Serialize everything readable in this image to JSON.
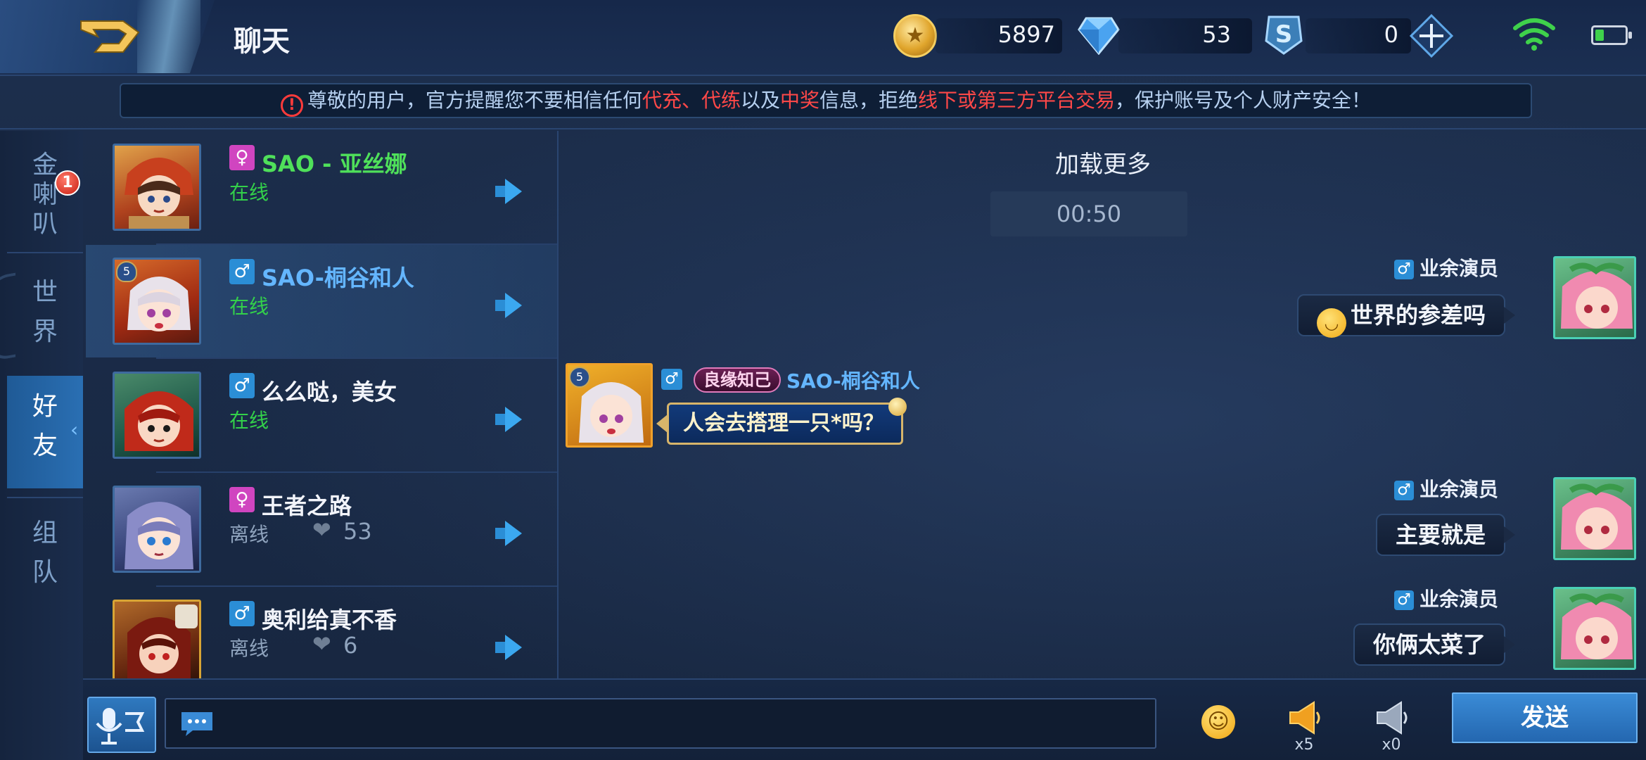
{
  "header": {
    "title": "聊天",
    "gold": "5897",
    "diamonds": "53",
    "vouchers": "0"
  },
  "notice": {
    "p1": "尊敬的用户，官方提醒您不要相信任何",
    "r1": "代充、代练",
    "p2": "以及",
    "r2": "中奖",
    "p3": "信息，拒绝",
    "r3": "线下或第三方平台交易",
    "p4": "，保护账号及个人财产安全！"
  },
  "tabs": [
    {
      "label": "金\n喇\n叭"
    },
    {
      "label": "世\n界"
    },
    {
      "label": "好\n友"
    },
    {
      "label": "组\n队"
    }
  ],
  "tab_badge": "1",
  "friends": [
    {
      "name": "SAO - 亚丝娜",
      "gender": "♀",
      "status": "在线",
      "name_color": "#4fe05a"
    },
    {
      "name": "SAO-桐谷和人",
      "gender": "♂",
      "status": "在线",
      "name_color": "#64b6ff",
      "level": "5"
    },
    {
      "name": "么么哒，美女",
      "gender": "♂",
      "status": "在线",
      "name_color": "#f2f4fa"
    },
    {
      "name": "王者之路",
      "gender": "♀",
      "status": "离线",
      "name_color": "#f2f4fa",
      "hearts": "53"
    },
    {
      "name": "奥利给真不香",
      "gender": "♂",
      "status": "离线",
      "name_color": "#f2f4fa",
      "hearts": "6"
    }
  ],
  "chat": {
    "load_more": "加载更多",
    "time": "00:50",
    "messages_right": [
      {
        "sender": "业余演员",
        "text": "世界的参差吗",
        "emoji": true
      },
      {
        "sender": "业余演员",
        "text": "主要就是"
      },
      {
        "sender": "业余演员",
        "text": "你俩太菜了"
      }
    ],
    "message_left": {
      "title_badge": "良缘知己",
      "sender": "SAO-桐谷和人",
      "level": "5",
      "text": "人会去搭理一只*吗？"
    }
  },
  "bottom": {
    "send": "发送",
    "horn_gold_count": "x5",
    "horn_gray_count": "x0"
  }
}
